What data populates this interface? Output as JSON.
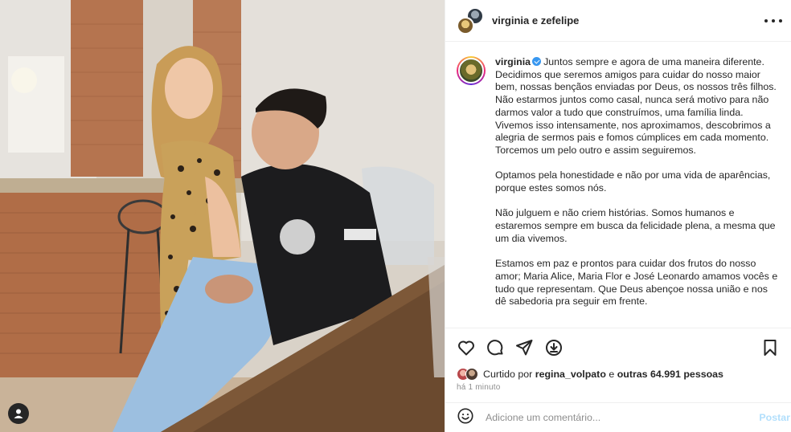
{
  "header": {
    "title": "virginia e zefelipe"
  },
  "post": {
    "author": "virginia",
    "paragraphs": [
      "Juntos sempre e agora de uma maneira diferente. Decidimos que seremos amigos para cuidar do nosso maior bem, nossas bençãos enviadas por Deus, os nossos três filhos. Não estarmos juntos como casal, nunca será motivo para não darmos valor a tudo que construímos, uma família linda. Vivemos isso intensamente, nos aproximamos, descobrimos a alegria de sermos pais e fomos cúmplices em cada momento. Torcemos um pelo outro e assim seguiremos.",
      "Optamos pela honestidade e não por uma vida de aparências, porque estes somos nós.",
      "Não julguem e não criem histórias. Somos humanos e estaremos sempre em busca da felicidade plena, a mesma que um dia vivemos.",
      "Estamos em paz e prontos para cuidar dos frutos do nosso amor; Maria Alice, Maria Flor e José Leonardo amamos vocês e tudo que representam. Que Deus abençoe nossa união e nos dê sabedoria pra seguir em frente."
    ]
  },
  "likes": {
    "prefix": "Curtido por",
    "user": "regina_volpato",
    "middle": "e",
    "others": "outras 64.991 pessoas"
  },
  "timestamp": "há 1 minuto",
  "comment": {
    "placeholder": "Adicione um comentário...",
    "post_label": "Postar"
  },
  "icons": {
    "like": "heart-icon",
    "comment": "comment-icon",
    "share": "send-icon",
    "save_alt": "download-icon",
    "bookmark": "bookmark-icon",
    "emoji": "smiley-icon",
    "more": "more-icon",
    "tag": "user-tag-icon"
  },
  "colors": {
    "verified": "#3897f0",
    "post_button": "#b2dffc",
    "muted": "#8e8e8e",
    "text": "#262626"
  }
}
